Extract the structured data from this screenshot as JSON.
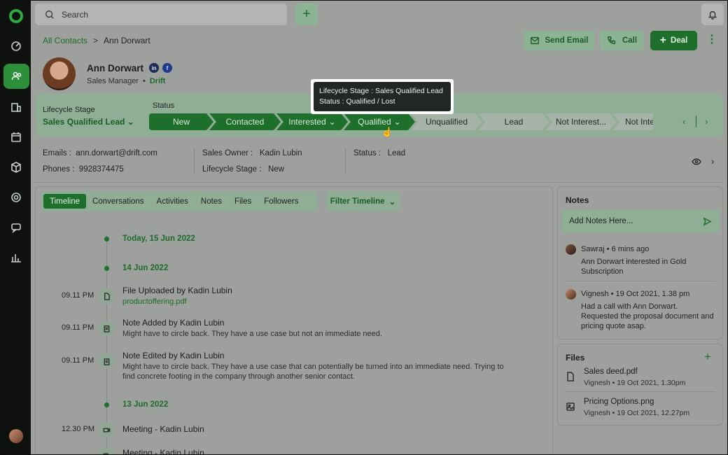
{
  "colors": {
    "accent": "#1e6e2c",
    "overlay": "#9ea09e"
  },
  "search": {
    "placeholder": "Search"
  },
  "breadcrumb": {
    "parent": "All Contacts",
    "separator": ">",
    "current": "Ann Dorwart"
  },
  "actions": {
    "send_email": "Send Email",
    "call": "Call",
    "deal": "Deal"
  },
  "contact": {
    "name": "Ann Dorwart",
    "role": "Sales Manager",
    "bullet": "•",
    "company": "Drift",
    "social": [
      "in",
      "f"
    ]
  },
  "lifecycle": {
    "label": "Lifecycle Stage",
    "value": "Sales Qualified Lead",
    "status_label": "Status"
  },
  "pipeline": [
    {
      "label": "New",
      "done": true
    },
    {
      "label": "Contacted",
      "done": true
    },
    {
      "label": "Interested",
      "done": true,
      "dropdown": true
    },
    {
      "label": "Qualified",
      "done": true,
      "dropdown": true
    },
    {
      "label": "Unqualified",
      "done": false
    },
    {
      "label": "Lead",
      "done": false
    },
    {
      "label": "Not Interest...",
      "done": false
    },
    {
      "label": "Not Inter",
      "done": false
    }
  ],
  "tooltip": {
    "line1": "Lifecycle Stage : Sales Qualified Lead",
    "line2": "Status : Qualified / Lost"
  },
  "info": {
    "emails_label": "Emails :",
    "emails": "ann.dorwart@drift.com",
    "phones_label": "Phones :",
    "phones": "9928374475",
    "owner_label": "Sales Owner :",
    "owner": "Kadin Lubin",
    "stage_label": "Lifecycle Stage :",
    "stage": "New",
    "status_label": "Status :",
    "status": "Lead"
  },
  "tabs": [
    "Timeline",
    "Conversations",
    "Activities",
    "Notes",
    "Files",
    "Followers"
  ],
  "filter_label": "Filter Timeline",
  "timeline": {
    "date1": "Today, 15 Jun 2022",
    "date2": "14 Jun 2022",
    "date3": "13 Jun 2022",
    "events": [
      {
        "time": "09.11 PM",
        "title": "File Uploaded by Kadin Lubin",
        "link": "productoffering.pdf"
      },
      {
        "time": "09.11 PM",
        "title": "Note Added by Kadin Lubin",
        "text": "Might have to circle back. They have a use case but not an immediate need."
      },
      {
        "time": "09.11 PM",
        "title": "Note Edited by Kadin Lubin",
        "text": "Might have to circle back. They have a use case that can potentially be turned into an immediate need. Trying to find concrete footing in the company through another senior contact."
      },
      {
        "time": "12.30 PM",
        "title": "Meeting - Kadin Lubin"
      },
      {
        "title": "Meeting - Kadin Lubin"
      }
    ]
  },
  "notes": {
    "title": "Notes",
    "placeholder": "Add Notes Here...",
    "items": [
      {
        "meta": "Sawraj • 6 mins ago",
        "text": "Ann Dorwart interested in Gold Subscription"
      },
      {
        "meta": "Vignesh  •  19 Oct 2021, 1.38 pm",
        "text": "Had a call with Ann Dorwart. Requested the proposal document and pricing quote asap."
      }
    ]
  },
  "files": {
    "title": "Files",
    "add": "+",
    "items": [
      {
        "name": "Sales deed.pdf",
        "meta": "Vignesh  •  19 Oct 2021, 1.30pm"
      },
      {
        "name": "Pricing Options.png",
        "meta": "Vignesh  •  19 Oct 2021, 12.27pm"
      }
    ]
  }
}
